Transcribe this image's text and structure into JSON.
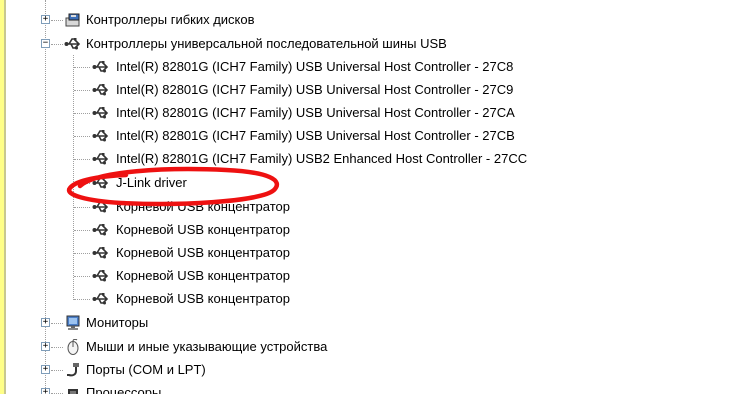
{
  "tree": {
    "floppy_controllers_label": "Контроллеры гибких дисков",
    "usb_controllers_label": "Контроллеры универсальной последовательной шины USB",
    "usb_children": [
      "Intel(R) 82801G (ICH7 Family) USB Universal Host Controller - 27C8",
      "Intel(R) 82801G (ICH7 Family) USB Universal Host Controller - 27C9",
      "Intel(R) 82801G (ICH7 Family) USB Universal Host Controller - 27CA",
      "Intel(R) 82801G (ICH7 Family) USB Universal Host Controller - 27CB",
      "Intel(R) 82801G (ICH7 Family) USB2 Enhanced Host Controller - 27CC",
      "J-Link driver",
      "Корневой USB концентратор",
      "Корневой USB концентратор",
      "Корневой USB концентратор",
      "Корневой USB концентратор",
      "Корневой USB концентратор"
    ],
    "monitors_label": "Мониторы",
    "mice_label": "Мыши и иные указывающие устройства",
    "ports_label": "Порты (COM и LPT)",
    "processors_label": "Процессоры"
  },
  "annotation_color": "#ee1111",
  "icons": {
    "floppy": "floppy-controller-icon",
    "usb": "usb-icon",
    "monitor": "monitor-icon",
    "mouse": "mouse-icon",
    "port": "port-icon",
    "cpu": "processor-icon"
  }
}
